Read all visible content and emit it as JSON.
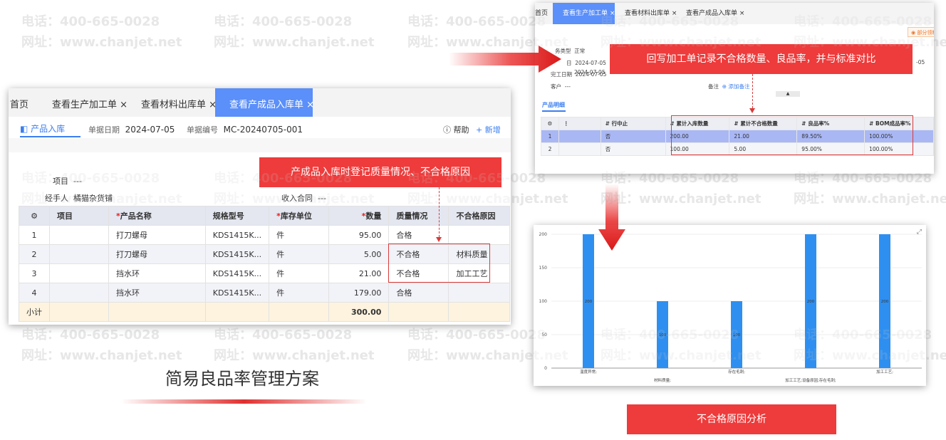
{
  "watermark": {
    "phone": "电话：400-665-0028",
    "url": "网址：www.chanjet.net"
  },
  "panel1": {
    "tabs": [
      "首页",
      "查看生产加工单 ×",
      "查看材料出库单 ×",
      "查看产成品入库单 ×"
    ],
    "doc_title": "产品入库",
    "doc_date_label": "单据日期",
    "doc_date": "2024-07-05",
    "doc_no_label": "单据编号",
    "doc_no": "MC-20240705-001",
    "help": "帮助",
    "add": "+ 新增",
    "field_project_label": "项目",
    "field_project_value": "---",
    "field_handler_label": "经手人",
    "field_handler_value": "橘猫杂货铺",
    "field_contract_label": "收入合同",
    "field_contract_value": "---",
    "columns": [
      "项目",
      "产品名称",
      "规格型号",
      "库存单位",
      "数量",
      "质量情况",
      "不合格原因"
    ],
    "rows": [
      {
        "idx": "1",
        "project": "",
        "name": "打刀螺母",
        "spec": "KDS1415K...",
        "unit": "件",
        "qty": "95.00",
        "quality": "合格",
        "reason": ""
      },
      {
        "idx": "2",
        "project": "",
        "name": "打刀螺母",
        "spec": "KDS1415K...",
        "unit": "件",
        "qty": "5.00",
        "quality": "不合格",
        "reason": "材料质量"
      },
      {
        "idx": "3",
        "project": "",
        "name": "挡水环",
        "spec": "KDS1415K...",
        "unit": "件",
        "qty": "21.00",
        "quality": "不合格",
        "reason": "加工工艺"
      },
      {
        "idx": "4",
        "project": "",
        "name": "挡水环",
        "spec": "KDS1415K...",
        "unit": "件",
        "qty": "179.00",
        "quality": "合格",
        "reason": ""
      }
    ],
    "subtotal_label": "小计",
    "subtotal_qty": "300.00",
    "callout": "产成品入库时登记质量情况、不合格原因"
  },
  "panel2": {
    "tabs": [
      "首页",
      "查看生产加工单 ×",
      "查看材料出库单 ×",
      "查看产成品入库单 ×"
    ],
    "badge": "部分领料",
    "fields": [
      {
        "label": "务类型",
        "value": "正常"
      },
      {
        "label": "日",
        "value": "2024-07-05"
      },
      {
        "label": "",
        "value": "2024-07-05"
      },
      {
        "label": "完工日期",
        "value": "2024-07-05"
      },
      {
        "label": "客户",
        "value": "---"
      }
    ],
    "right_date": "-05",
    "note_label": "备注",
    "note_add": "添加备注",
    "section": "产品明细",
    "columns": [
      "行中止",
      "累计入库数量",
      "累计不合格数量",
      "良品率%",
      "BOM成品率%"
    ],
    "rows": [
      {
        "idx": "1",
        "stop": "否",
        "in_qty": "200.00",
        "bad_qty": "21.00",
        "rate": "89.50%",
        "bom": "100.00%"
      },
      {
        "idx": "2",
        "stop": "否",
        "in_qty": "100.00",
        "bad_qty": "5.00",
        "rate": "95.00%",
        "bom": "100.00%"
      }
    ],
    "callout": "回写加工单记录不合格数量、良品率，并与标准对比"
  },
  "chart_data": {
    "type": "bar",
    "categories": [
      "温度异常;",
      "材料质量;",
      "存在毛刺;",
      "加工工艺;设备原因;存在毛刺;",
      "加工工艺;"
    ],
    "values": [
      200,
      100,
      100,
      200,
      200
    ],
    "data_labels": [
      "200",
      "100",
      "100",
      "200",
      "200"
    ],
    "yticks": [
      "0",
      "50",
      "100",
      "150",
      "200"
    ],
    "ylim": [
      0,
      200
    ],
    "color": "#2e8ff0"
  },
  "chart_callout": "不合格原因分析",
  "main_title": "简易良品率管理方案",
  "colors": {
    "accent": "#5b8ff9",
    "callout": "#ee3b3b",
    "bar": "#2e8ff0"
  }
}
